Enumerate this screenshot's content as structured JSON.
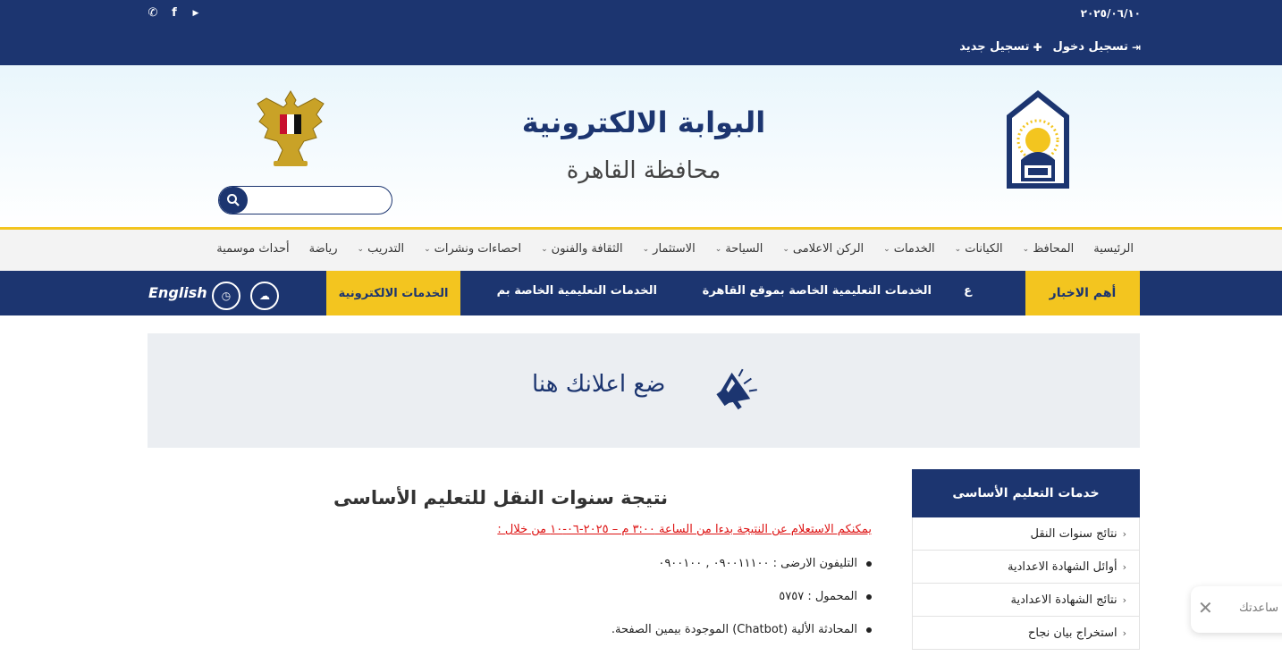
{
  "topbar": {
    "date": "٢٠٢٥/٠٦/١٠",
    "login": "تسجيل دخول",
    "register": "تسجيل جديد",
    "social": [
      "whatsapp-icon",
      "facebook-icon",
      "youtube-icon"
    ]
  },
  "header": {
    "title": "البوابة الالكترونية",
    "subtitle": "محافظة القاهرة",
    "search_placeholder": ""
  },
  "nav": {
    "items": [
      {
        "label": "الرئيسية",
        "dropdown": false
      },
      {
        "label": "المحافظ",
        "dropdown": true
      },
      {
        "label": "الكيانات",
        "dropdown": true
      },
      {
        "label": "الخدمات",
        "dropdown": true
      },
      {
        "label": "الركن الاعلامى",
        "dropdown": true
      },
      {
        "label": "السياحة",
        "dropdown": true
      },
      {
        "label": "الاستثمار",
        "dropdown": true
      },
      {
        "label": "الثقافة والفنون",
        "dropdown": true
      },
      {
        "label": "احصاءات ونشرات",
        "dropdown": true
      },
      {
        "label": "التدريب",
        "dropdown": true
      },
      {
        "label": "رياضة",
        "dropdown": false
      },
      {
        "label": "أحداث موسمية",
        "dropdown": false
      }
    ]
  },
  "newsbar": {
    "hot_label": "أهم الاخبار",
    "ticker_1": "الخدمات التعليمية الخاصة بموقع القاهرة",
    "ticker_2": "الخدمات التعليمية الخاصة بم",
    "ticker_yellow": "الخدمات الالكترونية",
    "ticker_edge": "ع",
    "english": "English"
  },
  "ad": {
    "text": "ضع اعلانك هنا"
  },
  "sidebar": {
    "title": "خدمات التعليم الأساسى",
    "items": [
      "نتائج سنوات النقل",
      "أوائل الشهادة الاعدادية",
      "نتائج الشهادة الاعدادية",
      "استخراج بيان نجاح"
    ]
  },
  "content": {
    "title": "نتيجة سنوات النقل للتعليم الأساسى",
    "note": "يمكنكم الاستعلام عن النتيجة بدءا من الساعة ٣:٠٠ م – ٢٠٢٥-٠٦-١٠ من خلال :",
    "bullets": [
      "التليفون الارضى : ٠٩٠٠١١١٠٠ , ٠٩٠٠١٠٠",
      "المحمول : ٥٧٥٧",
      "المحادثة الألية (Chatbot) الموجودة بيمين الصفحة."
    ]
  },
  "chat": {
    "text": "ساعدتك"
  },
  "colors": {
    "primary": "#1c3570",
    "accent": "#f3c51f",
    "alert": "#dd1111"
  }
}
